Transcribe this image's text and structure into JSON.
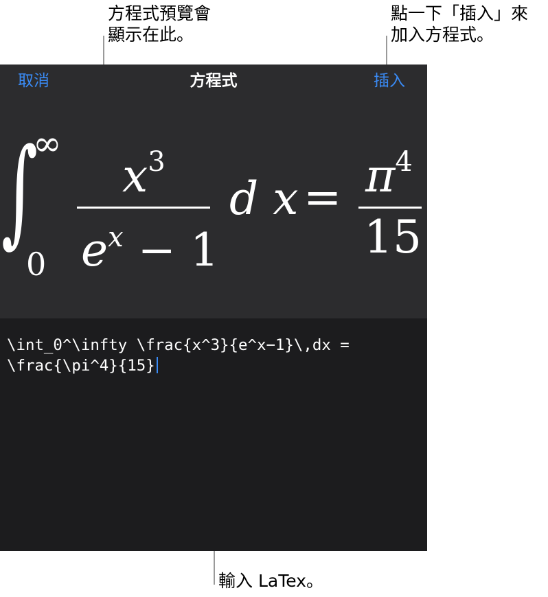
{
  "callouts": {
    "preview_note": "方程式預覽會\n顯示在此。",
    "insert_note": "點一下「插入」來\n加入方程式。",
    "latex_note": "輸入 LaTex。"
  },
  "navbar": {
    "cancel_label": "取消",
    "title": "方程式",
    "insert_label": "插入"
  },
  "preview": {
    "integral_sign": "∫",
    "lower_limit": "0",
    "upper_limit": "∞",
    "numerator_base": "x",
    "numerator_exp": "3",
    "denominator_base": "e",
    "denominator_exp": "x",
    "denominator_rest": "− 1",
    "differential": "d x",
    "equals": "=",
    "rhs_numerator_base": "π",
    "rhs_numerator_exp": "4",
    "rhs_denominator": "15"
  },
  "editor": {
    "latex_source": "\\int_0^\\infty \\frac{x^3}{e^x−1}\\,dx =\n\\frac{\\pi^4}{15}"
  },
  "colors": {
    "accent": "#3a8bf5",
    "panel_top": "#2c2c2e",
    "panel_bottom": "#1c1c1e",
    "leader_line": "#9a9a9a"
  }
}
